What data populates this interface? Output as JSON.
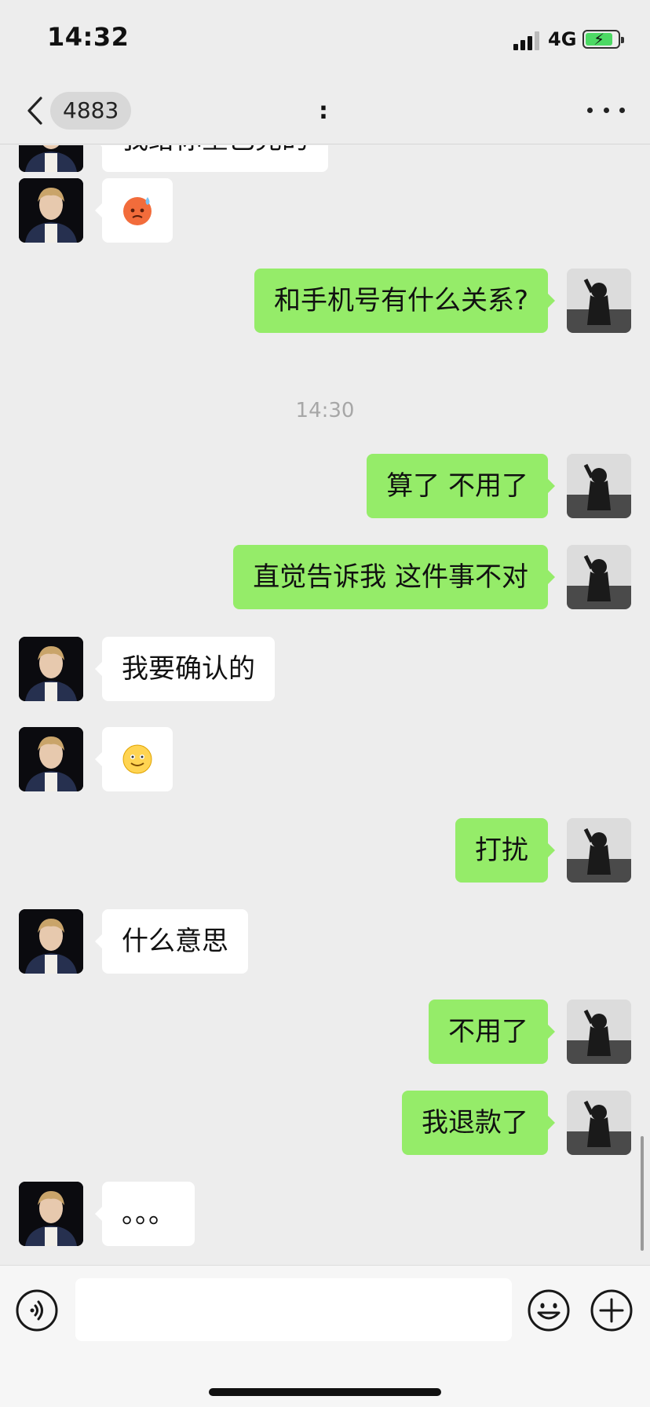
{
  "status_bar": {
    "time": "14:32",
    "network": "4G"
  },
  "nav": {
    "title": "4883",
    "title_suffix": ":"
  },
  "messages": [
    {
      "side": "peer",
      "type": "text",
      "text": "我给你垦已完的"
    },
    {
      "side": "peer",
      "type": "emoji",
      "emoji": "sweating-face"
    },
    {
      "side": "self",
      "type": "text",
      "text": "和手机号有什么关系?"
    },
    {
      "side": "self",
      "type": "text",
      "text": "算了 不用了"
    },
    {
      "side": "self",
      "type": "text",
      "text": "直觉告诉我 这件事不对"
    },
    {
      "side": "peer",
      "type": "text",
      "text": "我要确认的"
    },
    {
      "side": "peer",
      "type": "emoji",
      "emoji": "smiling-face"
    },
    {
      "side": "self",
      "type": "text",
      "text": "打扰"
    },
    {
      "side": "peer",
      "type": "text",
      "text": "什么意思"
    },
    {
      "side": "self",
      "type": "text",
      "text": "不用了"
    },
    {
      "side": "self",
      "type": "text",
      "text": "我退款了"
    },
    {
      "side": "peer",
      "type": "text",
      "text": "。。。"
    }
  ],
  "time_separator": "14:30",
  "input_bar": {
    "value": "",
    "placeholder": ""
  },
  "icons": [
    "back-chevron-icon",
    "more-icon",
    "voice-icon",
    "emoji-icon",
    "plus-icon"
  ],
  "colors": {
    "self_bubble": "#95ec69",
    "peer_bubble": "#ffffff",
    "background": "#ededed"
  }
}
